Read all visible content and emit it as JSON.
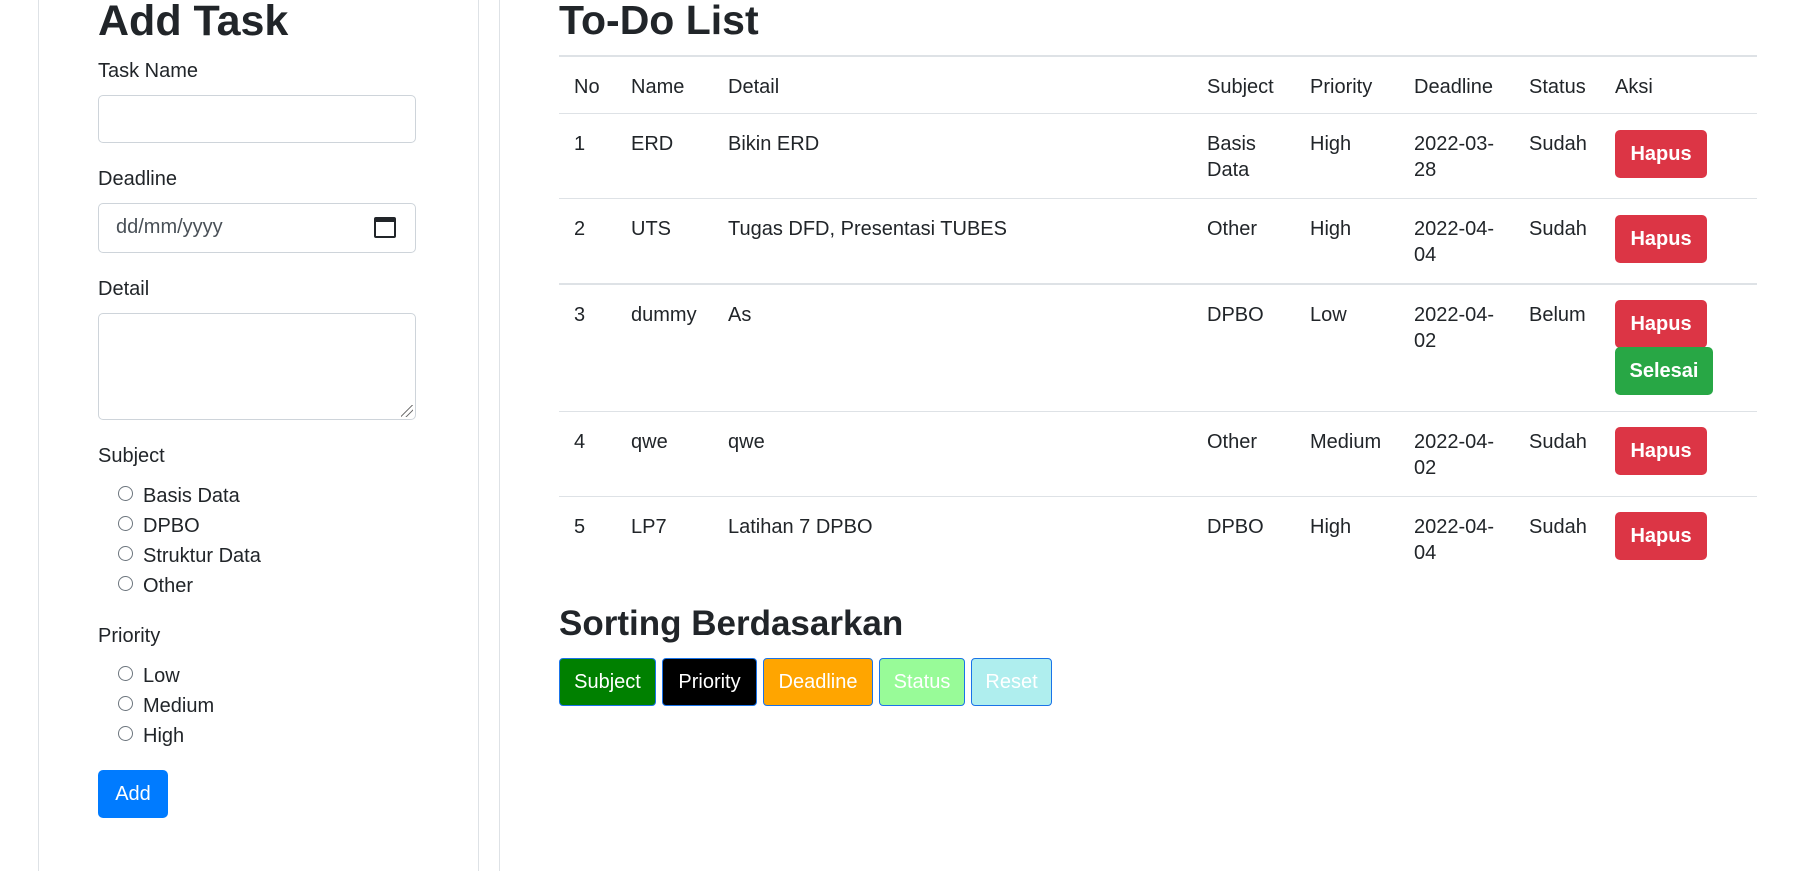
{
  "form": {
    "title": "Add Task",
    "task_name_label": "Task Name",
    "deadline_label": "Deadline",
    "deadline_placeholder": "dd/mm/yyyy",
    "detail_label": "Detail",
    "subject_label": "Subject",
    "subjects": [
      "Basis Data",
      "DPBO",
      "Struktur Data",
      "Other"
    ],
    "priority_label": "Priority",
    "priorities": [
      "Low",
      "Medium",
      "High"
    ],
    "add_label": "Add"
  },
  "list": {
    "title": "To-Do List",
    "headers": {
      "no": "No",
      "name": "Name",
      "detail": "Detail",
      "subject": "Subject",
      "priority": "Priority",
      "deadline": "Deadline",
      "status": "Status",
      "aksi": "Aksi"
    },
    "rows": [
      {
        "no": "1",
        "name": "ERD",
        "detail": "Bikin ERD",
        "subject_l1": "Basis",
        "subject_l2": "Data",
        "priority": "High",
        "deadline_l1": "2022-03-",
        "deadline_l2": "28",
        "status": "Sudah",
        "hapus": "Hapus"
      },
      {
        "no": "2",
        "name": "UTS",
        "detail": "Tugas DFD, Presentasi TUBES",
        "subject_l1": "Other",
        "subject_l2": "",
        "priority": "High",
        "deadline_l1": "2022-04-",
        "deadline_l2": "04",
        "status": "Sudah",
        "hapus": "Hapus"
      },
      {
        "no": "3",
        "name": "dummy",
        "detail": "As",
        "subject_l1": "DPBO",
        "subject_l2": "",
        "priority": "Low",
        "deadline_l1": "2022-04-",
        "deadline_l2": "02",
        "status": "Belum",
        "hapus": "Hapus",
        "selesai": "Selesai"
      },
      {
        "no": "4",
        "name": "qwe",
        "detail": "qwe",
        "subject_l1": "Other",
        "subject_l2": "",
        "priority": "Medium",
        "deadline_l1": "2022-04-",
        "deadline_l2": "02",
        "status": "Sudah",
        "hapus": "Hapus"
      },
      {
        "no": "5",
        "name": "LP7",
        "detail": "Latihan 7 DPBO",
        "subject_l1": "DPBO",
        "subject_l2": "",
        "priority": "High",
        "deadline_l1": "2022-04-",
        "deadline_l2": "04",
        "status": "Sudah",
        "hapus": "Hapus"
      }
    ]
  },
  "sorting": {
    "title": "Sorting Berdasarkan",
    "buttons": {
      "subject": "Subject",
      "priority": "Priority",
      "deadline": "Deadline",
      "status": "Status",
      "reset": "Reset"
    }
  },
  "colors": {
    "primary": "#007bff",
    "danger": "#dc3545",
    "success": "#28a745",
    "sort_subject": "#008000",
    "sort_priority": "#000000",
    "sort_deadline": "#ffa500",
    "sort_status": "#98fb98",
    "sort_reset": "#afeeee"
  }
}
